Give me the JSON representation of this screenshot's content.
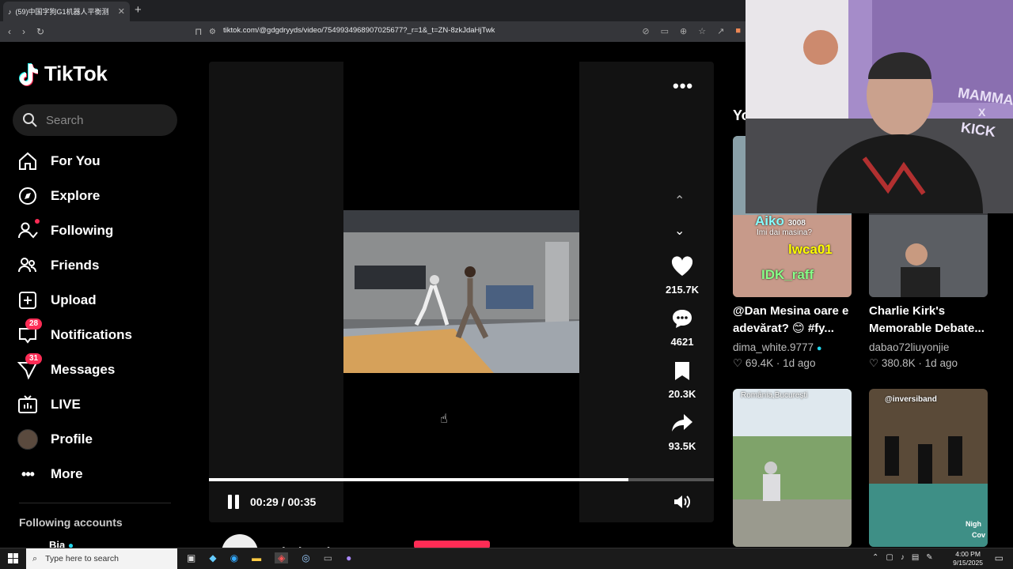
{
  "browser": {
    "tab_title": "(59)中国字狗G1机器人平衡测",
    "url": "tiktok.com/@gdgdryyds/video/7549934968907025677?_r=1&_t=ZN-8zkJdaHjTwk"
  },
  "app": {
    "name": "TikTok"
  },
  "search": {
    "placeholder": "Search"
  },
  "nav": [
    {
      "label": "For You",
      "icon": "home-icon"
    },
    {
      "label": "Explore",
      "icon": "compass-icon"
    },
    {
      "label": "Following",
      "icon": "following-icon"
    },
    {
      "label": "Friends",
      "icon": "friends-icon"
    },
    {
      "label": "Upload",
      "icon": "upload-icon"
    },
    {
      "label": "Notifications",
      "icon": "inbox-icon",
      "badge": "28"
    },
    {
      "label": "Messages",
      "icon": "send-icon",
      "badge": "31"
    },
    {
      "label": "LIVE",
      "icon": "live-tv-icon"
    },
    {
      "label": "Profile",
      "icon": "avatar-icon"
    },
    {
      "label": "More",
      "icon": "more-dots-icon"
    }
  ],
  "following_accounts": {
    "heading": "Following accounts",
    "first": "Bia"
  },
  "player": {
    "time": "00:29 / 00:35",
    "progress": 0.83,
    "author": "gdgdryyds",
    "likes": "215.7K",
    "comments": "4621",
    "saves": "20.3K",
    "shares": "93.5K"
  },
  "right_heading": "Yo",
  "cards": [
    {
      "title": "@Dan Mesina oare e adevărat? 😊 #fy...",
      "user": "dima_white.9777",
      "likes": "69.4K",
      "age": "1d ago",
      "verified": true
    },
    {
      "title": "Charlie Kirk's Memorable Debate...",
      "user": "dabao72liuyonjie",
      "likes": "380.8K",
      "age": "1d ago",
      "verified": false
    }
  ],
  "card_overlays": {
    "chat1": "Aiko",
    "chat1b": "3008",
    "chat_msg": "Imi dai masina?",
    "chat2": "lwca01",
    "chat3": "IDK_raff",
    "romania": "România,București",
    "inversiband": "@inversiband",
    "night": "Nigh",
    "cov": "Cov"
  },
  "cam_text": {
    "line1": "MAMMA",
    "line2": "X",
    "line3": "KICK"
  },
  "taskbar": {
    "search_placeholder": "Type here to search",
    "time": "4:00 PM",
    "date": "9/15/2025"
  },
  "colors": {
    "accent": "#fe2c55",
    "bg": "#000000",
    "panel": "#121212"
  }
}
